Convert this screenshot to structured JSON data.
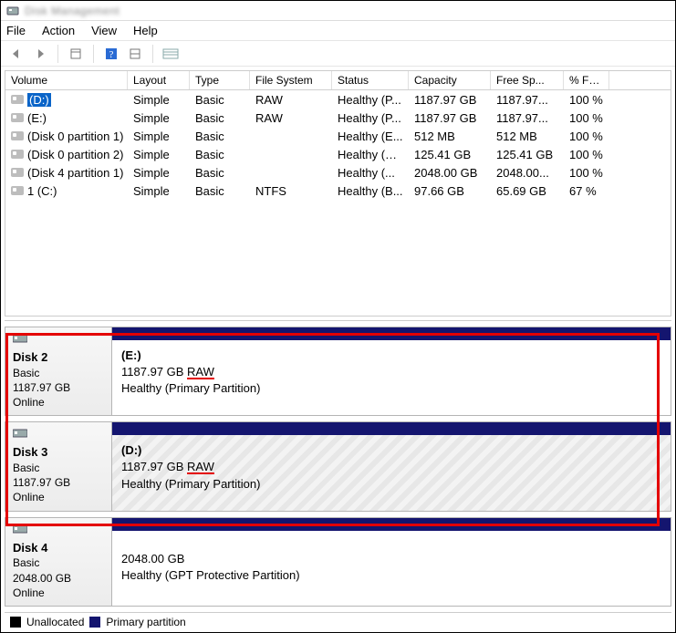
{
  "window": {
    "title": "Disk Management"
  },
  "menu": {
    "file": "File",
    "action": "Action",
    "view": "View",
    "help": "Help"
  },
  "columns": {
    "volume": "Volume",
    "layout": "Layout",
    "type": "Type",
    "fs": "File System",
    "status": "Status",
    "capacity": "Capacity",
    "free": "Free Sp...",
    "pctfree": "% Free"
  },
  "volumes": [
    {
      "name": "(D:)",
      "layout": "Simple",
      "type": "Basic",
      "fs": "RAW",
      "status": "Healthy (P...",
      "capacity": "1187.97 GB",
      "free": "1187.97...",
      "pctfree": "100 %",
      "selected": true
    },
    {
      "name": "(E:)",
      "layout": "Simple",
      "type": "Basic",
      "fs": "RAW",
      "status": "Healthy (P...",
      "capacity": "1187.97 GB",
      "free": "1187.97...",
      "pctfree": "100 %"
    },
    {
      "name": "(Disk 0 partition 1)",
      "layout": "Simple",
      "type": "Basic",
      "fs": "",
      "status": "Healthy (E...",
      "capacity": "512 MB",
      "free": "512 MB",
      "pctfree": "100 %"
    },
    {
      "name": "(Disk 0 partition 2)",
      "layout": "Simple",
      "type": "Basic",
      "fs": "",
      "status": "Healthy (R...",
      "capacity": "125.41 GB",
      "free": "125.41 GB",
      "pctfree": "100 %"
    },
    {
      "name": "(Disk 4 partition 1)",
      "layout": "Simple",
      "type": "Basic",
      "fs": "",
      "status": "Healthy (...",
      "capacity": "2048.00 GB",
      "free": "2048.00...",
      "pctfree": "100 %"
    },
    {
      "name": "1 (C:)",
      "layout": "Simple",
      "type": "Basic",
      "fs": "NTFS",
      "status": "Healthy (B...",
      "capacity": "97.66 GB",
      "free": "65.69 GB",
      "pctfree": "67 %"
    }
  ],
  "disks": [
    {
      "name": "Disk 2",
      "type": "Basic",
      "size": "1187.97 GB",
      "state": "Online",
      "part": {
        "drive": "(E:)",
        "size_prefix": "1187.97 GB ",
        "raw": "RAW",
        "status": "Healthy (Primary Partition)",
        "hatched": false
      }
    },
    {
      "name": "Disk 3",
      "type": "Basic",
      "size": "1187.97 GB",
      "state": "Online",
      "part": {
        "drive": "(D:)",
        "size_prefix": "1187.97 GB ",
        "raw": "RAW",
        "status": "Healthy (Primary Partition)",
        "hatched": true
      }
    },
    {
      "name": "Disk 4",
      "type": "Basic",
      "size": "2048.00 GB",
      "state": "Online",
      "part": {
        "drive": "",
        "size_prefix": "2048.00 GB",
        "raw": "",
        "status": "Healthy (GPT Protective Partition)",
        "hatched": false
      }
    }
  ],
  "legend": {
    "unallocated": "Unallocated",
    "primary": "Primary partition"
  }
}
